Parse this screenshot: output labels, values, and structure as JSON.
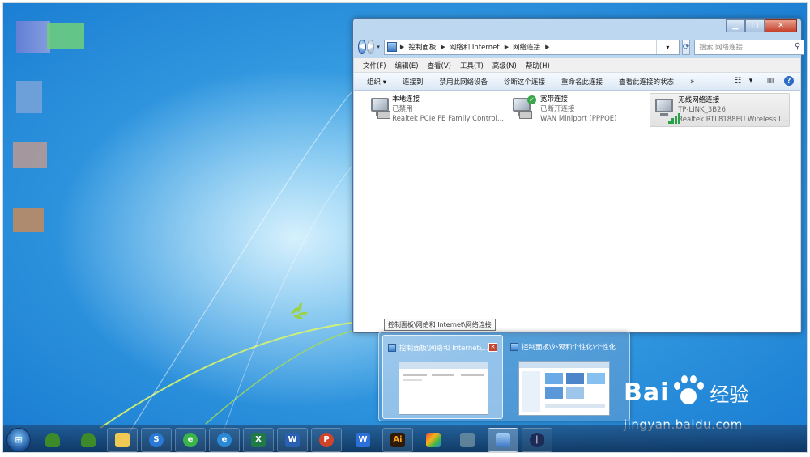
{
  "explorer": {
    "breadcrumb": [
      "控制面板",
      "网络和 Internet",
      "网络连接"
    ],
    "search_placeholder": "搜索 网络连接",
    "menu": [
      "文件(F)",
      "编辑(E)",
      "查看(V)",
      "工具(T)",
      "高级(N)",
      "帮助(H)"
    ],
    "toolbar": [
      "组织 ▾",
      "连接到",
      "禁用此网络设备",
      "诊断这个连接",
      "重命名此连接",
      "查看此连接的状态",
      "»"
    ],
    "connections": [
      {
        "name": "本地连接",
        "status": "已禁用",
        "device": "Realtek PCIe FE Family Control..."
      },
      {
        "name": "宽带连接",
        "status": "已断开连接",
        "device": "WAN Miniport (PPPOE)"
      },
      {
        "name": "无线网络连接",
        "status": "TP-LINK_3B26",
        "device": "Realtek RTL8188EU Wireless L..."
      }
    ]
  },
  "tooltip": "控制面板\\网络和 Internet\\网络连接",
  "thumbnails": [
    {
      "title": "控制面板\\网络和 Internet\\..."
    },
    {
      "title": "控制面板\\外观和个性化\\个性化"
    }
  ],
  "watermark": {
    "brand": "Bai",
    "brand_cn": "经验",
    "url": "jingyan.baidu.com"
  },
  "taskbar_apps": [
    "start-orb",
    "tree-app",
    "tree-app-2",
    "file-explorer",
    "sogou",
    "browser-e",
    "internet-explorer",
    "excel",
    "word",
    "powerpoint",
    "wps",
    "illustrator",
    "colorful-app",
    "image-app",
    "control-panel",
    "dark-app"
  ],
  "colors": {
    "accent": "#2c6bc5",
    "desktop": "#1c7fd3",
    "ok_badge": "#3aa84a"
  }
}
